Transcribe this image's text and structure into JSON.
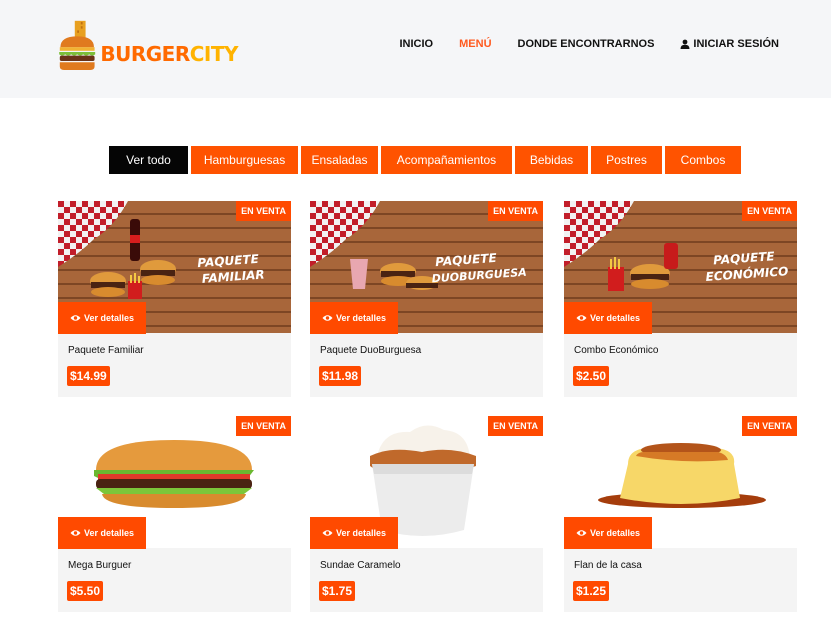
{
  "brand": {
    "part1": "BURGER",
    "part2": "CITY"
  },
  "nav": [
    {
      "label": "INICIO",
      "active": false
    },
    {
      "label": "MENÚ",
      "active": true
    },
    {
      "label": "DONDE ENCONTRARNOS",
      "active": false
    },
    {
      "label": "INICIAR SESIÓN",
      "active": false,
      "icon": "user-icon"
    }
  ],
  "filters": [
    {
      "label": "Ver todo",
      "active": true
    },
    {
      "label": "Hamburguesas",
      "active": false
    },
    {
      "label": "Ensaladas",
      "active": false
    },
    {
      "label": "Acompañamientos",
      "active": false
    },
    {
      "label": "Bebidas",
      "active": false
    },
    {
      "label": "Postres",
      "active": false
    },
    {
      "label": "Combos",
      "active": false
    }
  ],
  "products": [
    {
      "name": "Paquete Familiar",
      "price": "$14.99",
      "badge": "EN VENTA",
      "details_label": "Ver detalles",
      "sign_title_1": "PAQUETE",
      "sign_title_2": "FAMILIAR"
    },
    {
      "name": "Paquete DuoBurguesa",
      "price": "$11.98",
      "badge": "EN VENTA",
      "details_label": "Ver detalles",
      "sign_title_1": "PAQUETE",
      "sign_title_2": "DUOBURGUESA"
    },
    {
      "name": "Combo Económico",
      "price": "$2.50",
      "badge": "EN VENTA",
      "details_label": "Ver detalles",
      "sign_title_1": "PAQUETE",
      "sign_title_2": "ECONÓMICO"
    },
    {
      "name": "Mega Burguer",
      "price": "$5.50",
      "badge": "EN VENTA",
      "details_label": "Ver detalles"
    },
    {
      "name": "Sundae Caramelo",
      "price": "$1.75",
      "badge": "EN VENTA",
      "details_label": "Ver detalles"
    },
    {
      "name": "Flan de la casa",
      "price": "$1.25",
      "badge": "EN VENTA",
      "details_label": "Ver detalles"
    }
  ],
  "colors": {
    "accent": "#ff4a00",
    "nav_active": "#ff5a1f",
    "filter_active": "#050505"
  }
}
